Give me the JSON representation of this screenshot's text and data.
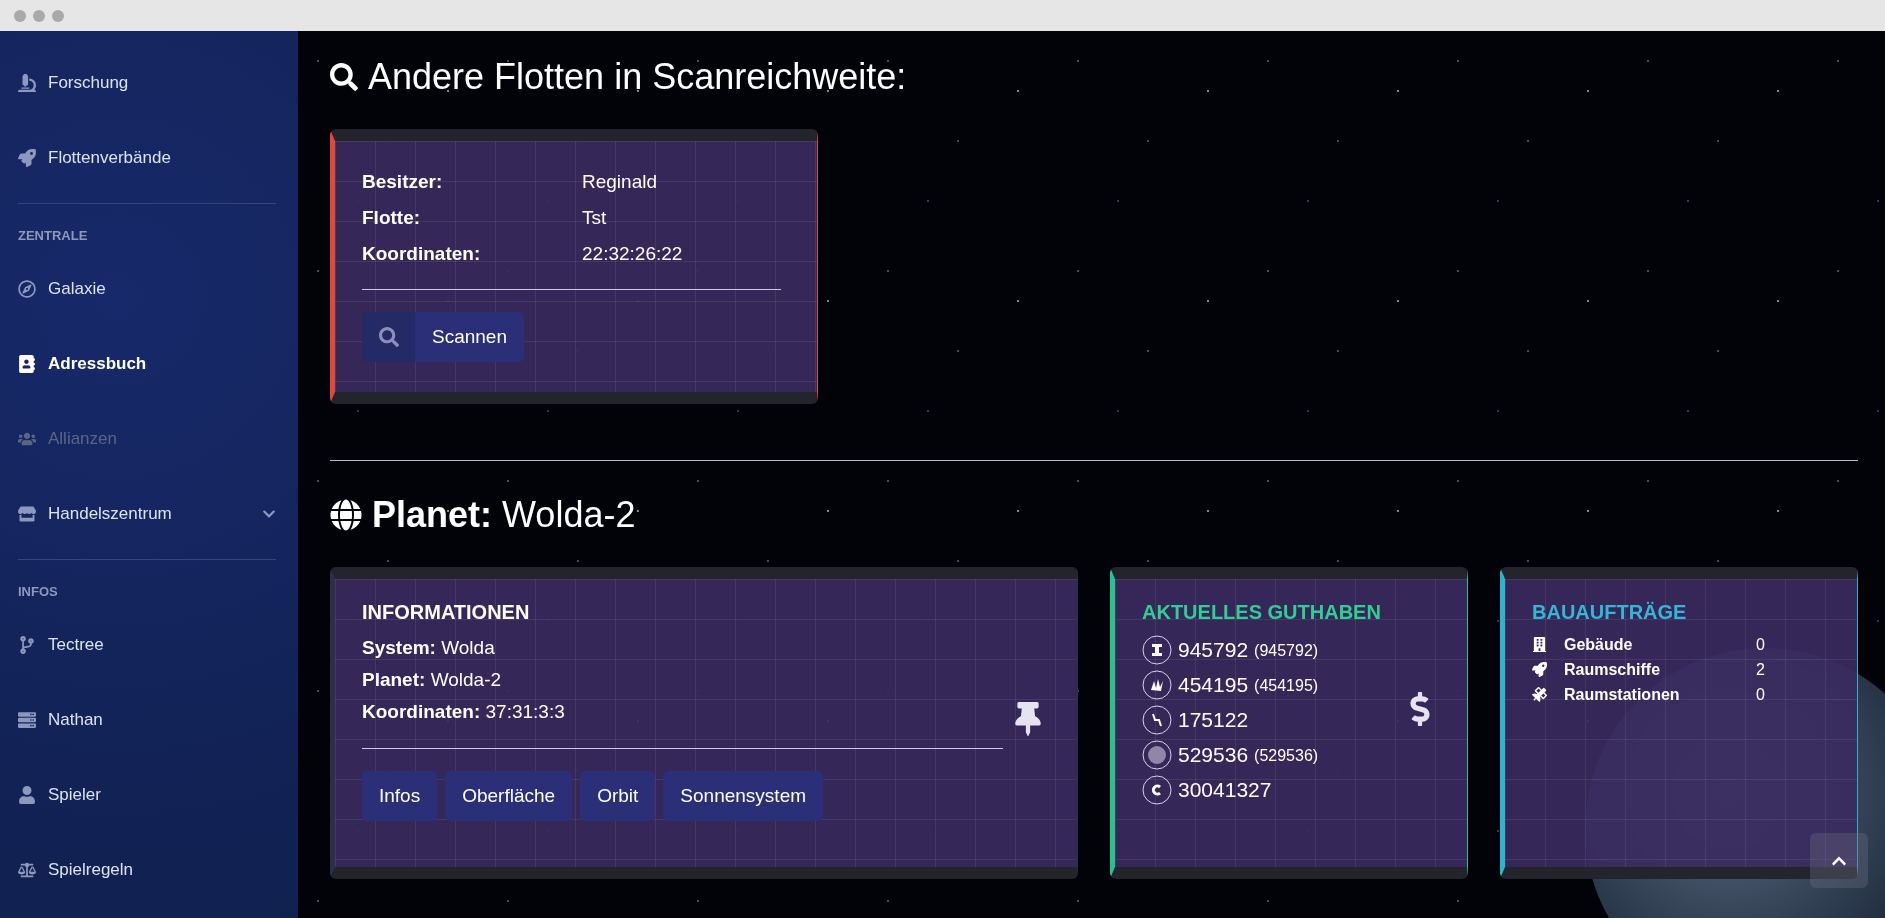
{
  "sidebar": {
    "groups": [
      {
        "items": [
          {
            "label": "Forschung",
            "selected": false,
            "disabled": false
          },
          {
            "label": "Flottenverbände",
            "selected": false,
            "disabled": false
          }
        ]
      },
      {
        "heading": "ZENTRALE",
        "items": [
          {
            "label": "Galaxie",
            "selected": false,
            "disabled": false
          },
          {
            "label": "Adressbuch",
            "selected": true,
            "disabled": false
          },
          {
            "label": "Allianzen",
            "selected": false,
            "disabled": true
          },
          {
            "label": "Handelszentrum",
            "selected": false,
            "disabled": false,
            "expandable": true
          }
        ]
      },
      {
        "heading": "INFOS",
        "items": [
          {
            "label": "Tectree",
            "selected": false,
            "disabled": false
          },
          {
            "label": "Nathan",
            "selected": false,
            "disabled": false
          },
          {
            "label": "Spieler",
            "selected": false,
            "disabled": false
          },
          {
            "label": "Spielregeln",
            "selected": false,
            "disabled": false
          }
        ]
      }
    ]
  },
  "fleets": {
    "title": "Andere Flotten in Scanreichweite:",
    "card": {
      "rows": [
        {
          "label": "Besitzer:",
          "value": "Reginald"
        },
        {
          "label": "Flotte:",
          "value": "Tst"
        },
        {
          "label": "Koordinaten:",
          "value": "22:32:26:22"
        }
      ],
      "button": "Scannen"
    }
  },
  "planet": {
    "title": "**Planet:** Wolda-2",
    "info": {
      "heading": "INFORMATIONEN",
      "lines": [
        "**System:** Wolda",
        "**Planet:** Wolda-2",
        "**Koordinaten:** 37:31:3:3"
      ],
      "buttons": [
        "Infos",
        "Oberfläche",
        "Orbit",
        "Sonnensystem"
      ]
    },
    "balance": {
      "heading": "AKTUELLES GUTHABEN",
      "resources": [
        {
          "value": "945792",
          "extra": "(945792)"
        },
        {
          "value": "454195",
          "extra": "(454195)"
        },
        {
          "value": "175122"
        },
        {
          "value": "529536",
          "extra": "(529536)"
        },
        {
          "value": "30041327"
        }
      ]
    },
    "orders": {
      "heading": "BAUAUFTRÄGE",
      "rows": [
        {
          "label": "Gebäude",
          "count": "0"
        },
        {
          "label": "Raumschiffe",
          "count": "2"
        },
        {
          "label": "Raumstationen",
          "count": "0"
        }
      ]
    }
  }
}
